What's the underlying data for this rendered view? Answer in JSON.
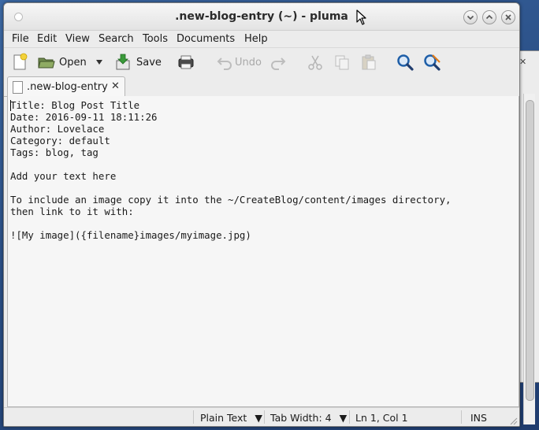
{
  "window": {
    "title": ".new-blog-entry (~) - pluma"
  },
  "menubar": {
    "items": [
      "File",
      "Edit",
      "View",
      "Search",
      "Tools",
      "Documents",
      "Help"
    ]
  },
  "toolbar": {
    "open_label": "Open",
    "save_label": "Save",
    "undo_label": "Undo"
  },
  "tabs": [
    {
      "label": ".new-blog-entry"
    }
  ],
  "editor": {
    "content": "Title: Blog Post Title\nDate: 2016-09-11 18:11:26\nAuthor: Lovelace\nCategory: default\nTags: blog, tag\n\nAdd your text here\n\nTo include an image copy it into the ~/CreateBlog/content/images directory,\nthen link to it with:\n\n![My image]({filename}images/myimage.jpg)"
  },
  "statusbar": {
    "language": "Plain Text",
    "tab_width": "Tab Width:  4",
    "position": "Ln 1, Col 1",
    "mode": "INS"
  },
  "colors": {
    "desktop": "#2a4f86",
    "window_bg": "#ececec",
    "editor_bg": "#f6f6f6",
    "search_icon": "#1f5fa8"
  }
}
